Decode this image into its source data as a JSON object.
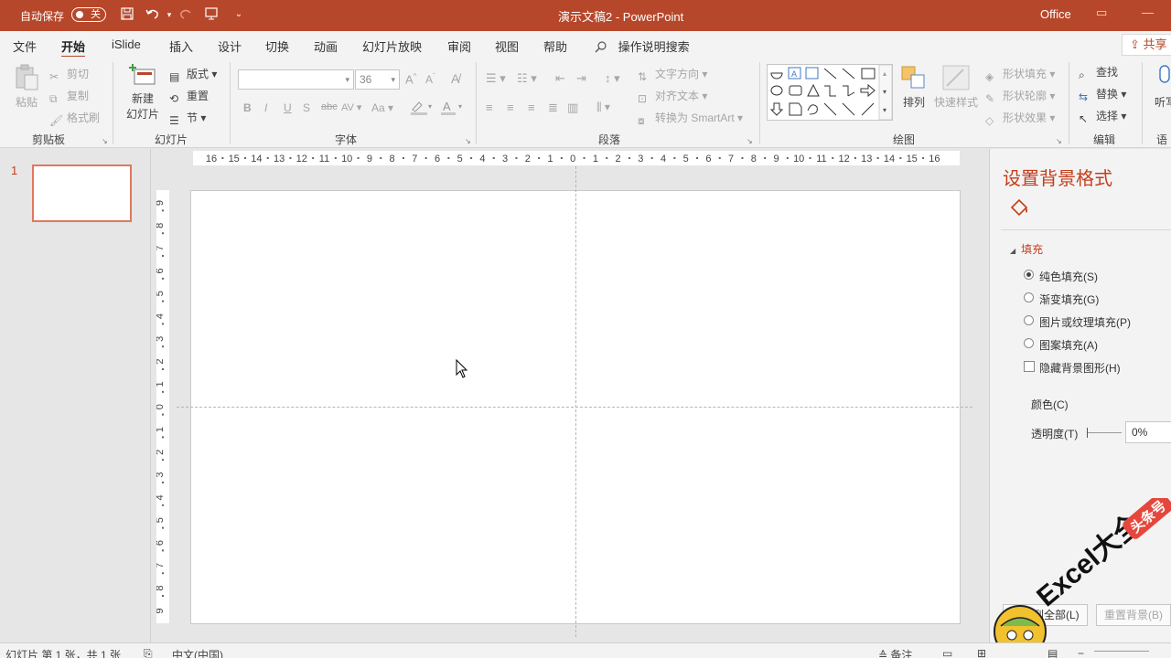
{
  "titlebar": {
    "autosave_label": "自动保存",
    "autosave_state": "关",
    "doc_title": "演示文稿2  -  PowerPoint",
    "account": "Office"
  },
  "menu": {
    "tabs": [
      "文件",
      "开始",
      "iSlide",
      "插入",
      "设计",
      "切换",
      "动画",
      "幻灯片放映",
      "审阅",
      "视图",
      "帮助"
    ],
    "active_tab": "开始",
    "search_label": "操作说明搜索",
    "share_label": "共享"
  },
  "ribbon": {
    "clipboard": {
      "paste": "粘贴",
      "cut": "剪切",
      "copy": "复制",
      "format_painter": "格式刷",
      "group": "剪贴板"
    },
    "slides": {
      "new_slide_line1": "新建",
      "new_slide_line2": "幻灯片",
      "layout": "版式",
      "reset": "重置",
      "section": "节",
      "group": "幻灯片"
    },
    "font": {
      "font_name": "",
      "font_size": "36",
      "group": "字体",
      "bold": "B",
      "italic": "I",
      "underline": "U",
      "shadow": "S",
      "strike": "abc",
      "spacing": "AV",
      "case": "Aa"
    },
    "paragraph": {
      "text_direction": "文字方向",
      "align_text": "对齐文本",
      "smartart": "转换为 SmartArt",
      "group": "段落"
    },
    "drawing": {
      "arrange": "排列",
      "quick_styles": "快速样式",
      "shape_fill": "形状填充",
      "shape_outline": "形状轮廓",
      "shape_effects": "形状效果",
      "group": "绘图"
    },
    "editing": {
      "find": "查找",
      "replace": "替换",
      "select": "选择",
      "group": "编辑"
    },
    "voice": {
      "dictate": "听写",
      "group": "语音"
    }
  },
  "thumbnails": {
    "slide_number": "1"
  },
  "ruler": {
    "h_labels": [
      "16",
      "15",
      "14",
      "13",
      "12",
      "11",
      "10",
      "9",
      "8",
      "7",
      "6",
      "5",
      "4",
      "3",
      "2",
      "1",
      "0",
      "1",
      "2",
      "3",
      "4",
      "5",
      "6",
      "7",
      "8",
      "9",
      "10",
      "11",
      "12",
      "13",
      "14",
      "15",
      "16"
    ],
    "v_labels": [
      "9",
      "8",
      "7",
      "6",
      "5",
      "4",
      "3",
      "2",
      "1",
      "0",
      "1",
      "2",
      "3",
      "4",
      "5",
      "6",
      "7",
      "8",
      "9"
    ]
  },
  "format_pane": {
    "title": "设置背景格式",
    "section": "填充",
    "options": [
      {
        "label": "纯色填充(S)",
        "selected": true
      },
      {
        "label": "渐变填充(G)",
        "selected": false
      },
      {
        "label": "图片或纹理填充(P)",
        "selected": false
      },
      {
        "label": "图案填充(A)",
        "selected": false
      }
    ],
    "hide_bg_graphics": "隐藏背景图形(H)",
    "color_label": "颜色(C)",
    "transparency_label": "透明度(T)",
    "transparency_value": "0%",
    "apply_all": "应用到全部(L)",
    "reset_bg": "重置背景(B)"
  },
  "watermark": {
    "text": "Excel大全",
    "badge": "头条号"
  },
  "statusbar": {
    "slide_info": "幻灯片 第 1 张，共 1 张",
    "language": "中文(中国)",
    "notes": "备注"
  },
  "colors": {
    "accent": "#b7472a",
    "accent_text": "#c43e1c"
  }
}
